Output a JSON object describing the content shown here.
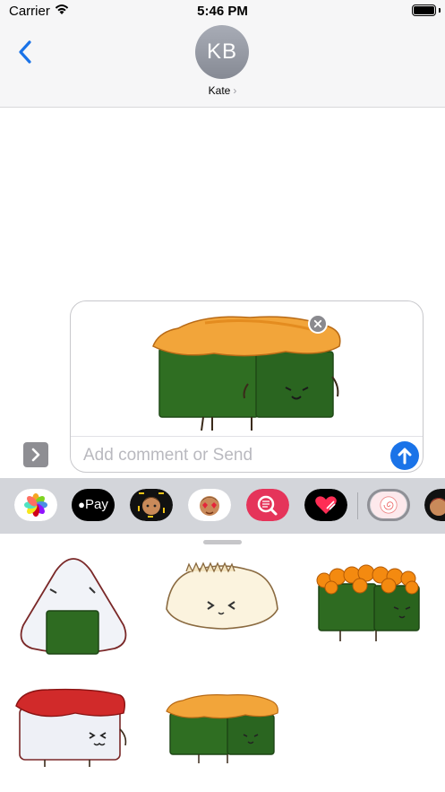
{
  "status_bar": {
    "carrier": "Carrier",
    "time": "5:46 PM"
  },
  "header": {
    "avatar_initials": "KB",
    "contact_name": "Kate"
  },
  "compose": {
    "placeholder": "Add comment or Send"
  },
  "app_drawer": {
    "apps": [
      "photos-app",
      "apple-pay-app",
      "memoji-app",
      "animoji-app",
      "image-search-app",
      "digital-touch-app",
      "sticker-pack-app",
      "more-memoji-app"
    ],
    "apple_pay_label": "Pay"
  },
  "stickers": [
    "onigiri",
    "gyoza",
    "ikura-gunkan",
    "maguro-nigiri",
    "uni-gunkan"
  ],
  "colors": {
    "accent": "#1a73e8",
    "seaweed": "#2e6b21",
    "uni": "#f2a53a",
    "tuna": "#d22a2a"
  }
}
